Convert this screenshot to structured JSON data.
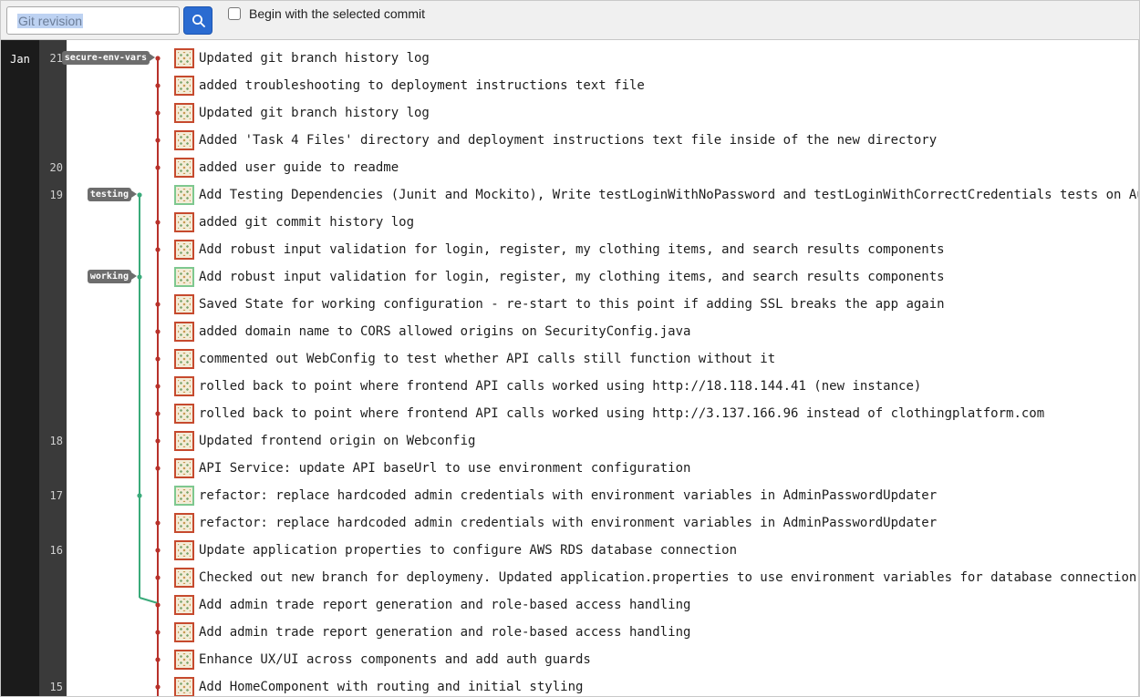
{
  "toolbar": {
    "revision_placeholder": "Git revision",
    "begin_with_selected_label": "Begin with the selected commit",
    "begin_with_selected_checked": false
  },
  "dates": {
    "month": "Jan",
    "days": [
      {
        "label": "21",
        "row": 0
      },
      {
        "label": "20",
        "row": 4
      },
      {
        "label": "19",
        "row": 5
      },
      {
        "label": "18",
        "row": 14
      },
      {
        "label": "17",
        "row": 16
      },
      {
        "label": "16",
        "row": 18
      },
      {
        "label": "15",
        "row": 23
      }
    ]
  },
  "colors": {
    "main_branch": "#b8312a",
    "side_branch": "#3aaa7a",
    "ref_tag": "#6d6d6d",
    "search_button": "#2a6bd1"
  },
  "refs": [
    {
      "name": "secure-env-vars",
      "row": 0,
      "lane": "main"
    },
    {
      "name": "testing",
      "row": 5,
      "lane": "side"
    },
    {
      "name": "working",
      "row": 8,
      "lane": "side"
    }
  ],
  "commits": [
    {
      "message": "Updated git branch history log",
      "lane": "main"
    },
    {
      "message": "added troubleshooting to deployment instructions text file",
      "lane": "main"
    },
    {
      "message": "Updated git branch history log",
      "lane": "main"
    },
    {
      "message": "Added 'Task 4 Files' directory and deployment instructions text file inside of the new directory",
      "lane": "main"
    },
    {
      "message": "added user guide to readme",
      "lane": "main"
    },
    {
      "message": "Add Testing Dependencies (Junit and Mockito), Write testLoginWithNoPassword and testLoginWithCorrectCredentials tests on AuthController",
      "lane": "side"
    },
    {
      "message": "added git commit history log",
      "lane": "main"
    },
    {
      "message": "Add robust input validation for login, register, my clothing items, and search results components",
      "lane": "main"
    },
    {
      "message": "Add robust input validation for login, register, my clothing items, and search results components",
      "lane": "side"
    },
    {
      "message": "Saved State for working configuration - re-start to this point if adding SSL breaks the app again",
      "lane": "main"
    },
    {
      "message": "added domain name to CORS allowed origins on SecurityConfig.java",
      "lane": "main"
    },
    {
      "message": "commented out WebConfig to test whether API calls still function without it",
      "lane": "main"
    },
    {
      "message": "rolled back to point where frontend API calls worked using http://18.118.144.41 (new instance)",
      "lane": "main"
    },
    {
      "message": "rolled back to point where frontend API calls worked using http://3.137.166.96 instead of clothingplatform.com",
      "lane": "main"
    },
    {
      "message": "Updated frontend origin on Webconfig",
      "lane": "main"
    },
    {
      "message": "API Service: update API baseUrl to use environment configuration",
      "lane": "main"
    },
    {
      "message": "refactor: replace hardcoded admin credentials with environment variables in AdminPasswordUpdater",
      "lane": "side"
    },
    {
      "message": "refactor: replace hardcoded admin credentials with environment variables in AdminPasswordUpdater",
      "lane": "main"
    },
    {
      "message": "Update application properties to configure AWS RDS database connection",
      "lane": "main"
    },
    {
      "message": "Checked out new branch for deploymeny. Updated application.properties to use environment variables for database connection",
      "lane": "main"
    },
    {
      "message": "Add admin trade report generation and role-based access handling",
      "lane": "main"
    },
    {
      "message": "Add admin trade report generation and role-based access handling",
      "lane": "main"
    },
    {
      "message": "Enhance UX/UI across components and add auth guards",
      "lane": "main"
    },
    {
      "message": "Add HomeComponent with routing and initial styling",
      "lane": "main"
    }
  ]
}
